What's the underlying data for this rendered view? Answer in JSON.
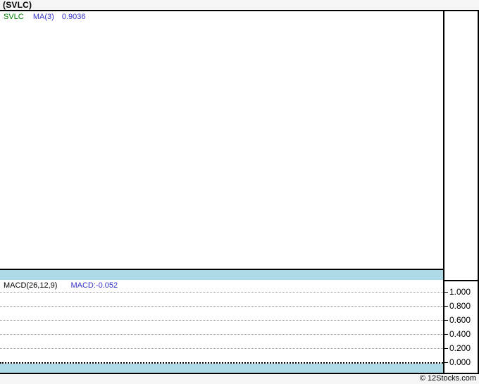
{
  "window": {
    "title": "(SVLC)"
  },
  "main_chart": {
    "legend": {
      "symbol": "SVLC",
      "ma_label": "MA(3)",
      "ma_value": "0.9036"
    }
  },
  "macd_panel": {
    "label": "MACD(26,12,9)",
    "value_label": "MACD:-0.052"
  },
  "macd_axis": {
    "ticks": [
      "1.000",
      "0.800",
      "0.600",
      "0.400",
      "0.200",
      "0.000"
    ]
  },
  "footer": {
    "copyright": "© 12Stocks.com"
  },
  "colors": {
    "background": "#f5f5f5",
    "panel_background": "#ffffff",
    "separator_band": "#add8e6",
    "border": "#000000",
    "gridline": "#999999",
    "legend_symbol_green": "#008000",
    "legend_value_blue": "#3333cc"
  },
  "chart_data": [
    {
      "type": "line",
      "title": "(SVLC)",
      "series": [
        {
          "name": "SVLC",
          "values": []
        },
        {
          "name": "MA(3)",
          "values": [],
          "last_value": 0.9036
        }
      ],
      "legend_position": "top-left",
      "grid": false,
      "note": "price panel is rendered empty; only legend with last MA(3) value 0.9036 is shown"
    },
    {
      "type": "line",
      "title": "MACD(26,12,9)",
      "series": [
        {
          "name": "MACD",
          "values": [],
          "last_value": -0.052
        }
      ],
      "ylim": [
        0.0,
        1.0
      ],
      "yticks": [
        1.0,
        0.8,
        0.6,
        0.4,
        0.2,
        0.0
      ],
      "y_axis_side": "right",
      "legend_position": "top-left",
      "grid": true,
      "note": "MACD panel rendered with horizontal dotted gridlines only; current MACD value -0.052"
    }
  ]
}
